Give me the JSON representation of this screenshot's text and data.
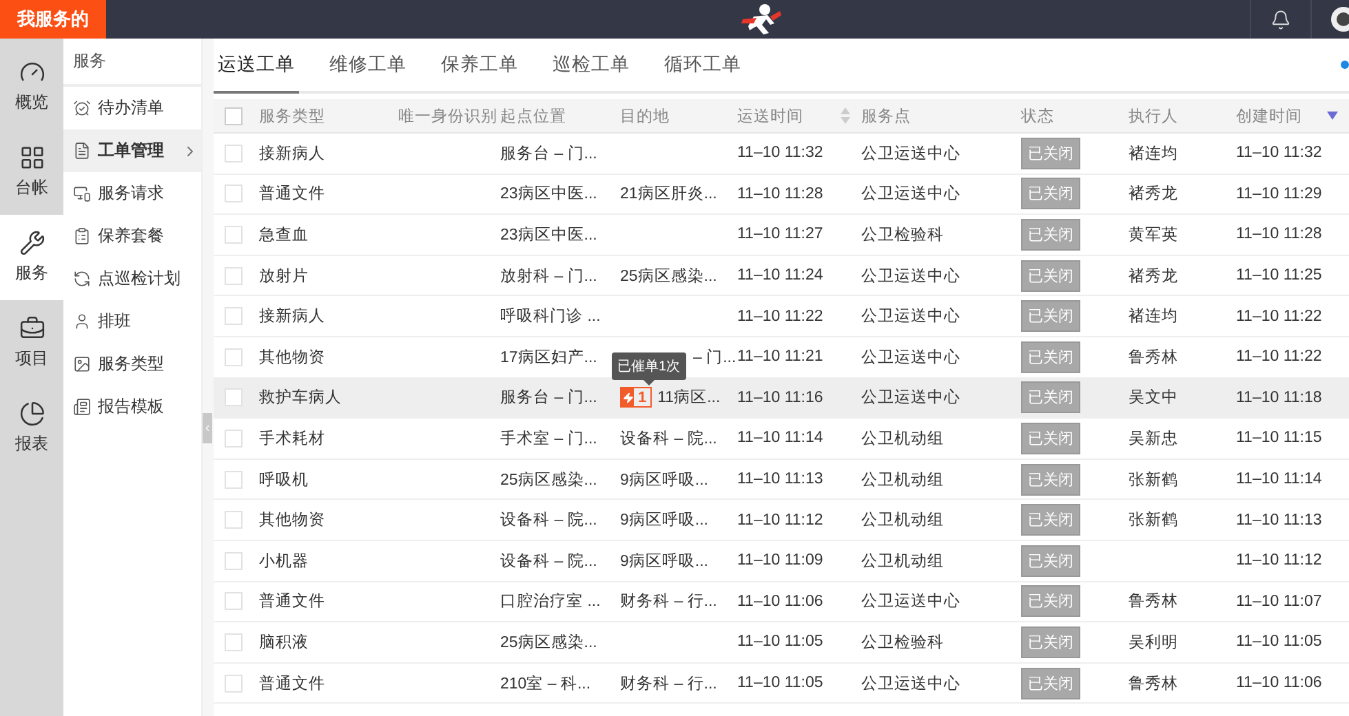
{
  "top_bar": {
    "title": "我服务的"
  },
  "rail": [
    {
      "label": "概览",
      "selected": false
    },
    {
      "label": "台帐",
      "selected": false
    },
    {
      "label": "服务",
      "selected": true
    },
    {
      "label": "项目",
      "selected": false
    },
    {
      "label": "报表",
      "selected": false
    }
  ],
  "sidebar": {
    "header": "服务",
    "items": [
      {
        "label": "待办清单",
        "selected": false,
        "expandable": false
      },
      {
        "label": "工单管理",
        "selected": true,
        "expandable": true
      },
      {
        "label": "服务请求",
        "selected": false,
        "expandable": false
      },
      {
        "label": "保养套餐",
        "selected": false,
        "expandable": false
      },
      {
        "label": "点巡检计划",
        "selected": false,
        "expandable": false
      },
      {
        "label": "排班",
        "selected": false,
        "expandable": false
      },
      {
        "label": "服务类型",
        "selected": false,
        "expandable": false
      },
      {
        "label": "报告模板",
        "selected": false,
        "expandable": false
      }
    ]
  },
  "tabs": [
    {
      "label": "运送工单",
      "selected": true
    },
    {
      "label": "维修工单",
      "selected": false
    },
    {
      "label": "保养工单",
      "selected": false
    },
    {
      "label": "巡检工单",
      "selected": false
    },
    {
      "label": "循环工单",
      "selected": false
    }
  ],
  "table": {
    "all_checked": false,
    "columns": [
      {
        "label": "服务类型"
      },
      {
        "label": "唯一身份识别"
      },
      {
        "label": "起点位置"
      },
      {
        "label": "目的地"
      },
      {
        "label": "运送时间",
        "sortable": true,
        "sorted": false
      },
      {
        "label": "服务点"
      },
      {
        "label": "状态"
      },
      {
        "label": "执行人"
      },
      {
        "label": "创建时间",
        "sortable": true,
        "sorted": true
      }
    ],
    "rows": [
      {
        "checked": false,
        "hovered": false,
        "type": "接新病人",
        "start": "服务台 – 门...",
        "destination": "",
        "time": "11–10 11:32",
        "point": "公卫运送中心",
        "status": "已关闭",
        "executor": "褚连均",
        "created": "11–10 11:32"
      },
      {
        "checked": false,
        "hovered": false,
        "type": "普通文件",
        "start": "23病区中医...",
        "destination": "21病区肝炎...",
        "time": "11–10 11:28",
        "point": "公卫运送中心",
        "status": "已关闭",
        "executor": "褚秀龙",
        "created": "11–10 11:29"
      },
      {
        "checked": false,
        "hovered": false,
        "type": "急查血",
        "start": "23病区中医...",
        "destination": "",
        "time": "11–10 11:27",
        "point": "公卫检验科",
        "status": "已关闭",
        "executor": "黄军英",
        "created": "11–10 11:28"
      },
      {
        "checked": false,
        "hovered": false,
        "type": "放射片",
        "start": "放射科 – 门...",
        "destination": "25病区感染...",
        "time": "11–10 11:24",
        "point": "公卫运送中心",
        "status": "已关闭",
        "executor": "褚秀龙",
        "created": "11–10 11:25"
      },
      {
        "checked": false,
        "hovered": false,
        "type": "接新病人",
        "start": "呼吸科门诊 ...",
        "destination": "",
        "time": "11–10 11:22",
        "point": "公卫运送中心",
        "status": "已关闭",
        "executor": "褚连均",
        "created": "11–10 11:22"
      },
      {
        "checked": false,
        "hovered": false,
        "type": "其他物资",
        "start": "17病区妇产...",
        "destination": "– 门...",
        "time": "11–10 11:21",
        "point": "公卫运送中心",
        "status": "已关闭",
        "executor": "鲁秀林",
        "created": "11–10 11:22"
      },
      {
        "checked": false,
        "hovered": true,
        "type": "救护车病人",
        "start": "服务台 – 门...",
        "urge": {
          "count": "1",
          "tooltip": "已催单1次"
        },
        "destination": "11病区...",
        "time": "11–10 11:16",
        "point": "公卫运送中心",
        "status": "已关闭",
        "executor": "吴文中",
        "created": "11–10 11:18"
      },
      {
        "checked": false,
        "hovered": false,
        "type": "手术耗材",
        "start": "手术室 – 门...",
        "destination": "设备科 – 院...",
        "time": "11–10 11:14",
        "point": "公卫机动组",
        "status": "已关闭",
        "executor": "吴新忠",
        "created": "11–10 11:15"
      },
      {
        "checked": false,
        "hovered": false,
        "type": "呼吸机",
        "start": "25病区感染...",
        "destination": "9病区呼吸...",
        "time": "11–10 11:13",
        "point": "公卫机动组",
        "status": "已关闭",
        "executor": "张新鹤",
        "created": "11–10 11:14"
      },
      {
        "checked": false,
        "hovered": false,
        "type": "其他物资",
        "start": "设备科 – 院...",
        "destination": "9病区呼吸...",
        "time": "11–10 11:12",
        "point": "公卫机动组",
        "status": "已关闭",
        "executor": "张新鹤",
        "created": "11–10 11:13"
      },
      {
        "checked": false,
        "hovered": false,
        "type": "小机器",
        "start": "设备科 – 院...",
        "destination": "9病区呼吸...",
        "time": "11–10 11:09",
        "point": "公卫机动组",
        "status": "已关闭",
        "executor": "",
        "created": "11–10 11:12"
      },
      {
        "checked": false,
        "hovered": false,
        "type": "普通文件",
        "start": "口腔治疗室 ...",
        "destination": "财务科 – 行...",
        "time": "11–10 11:06",
        "point": "公卫运送中心",
        "status": "已关闭",
        "executor": "鲁秀林",
        "created": "11–10 11:07"
      },
      {
        "checked": false,
        "hovered": false,
        "type": "脑积液",
        "start": "25病区感染...",
        "destination": "",
        "time": "11–10 11:05",
        "point": "公卫检验科",
        "status": "已关闭",
        "executor": "吴利明",
        "created": "11–10 11:05"
      },
      {
        "checked": false,
        "hovered": false,
        "type": "普通文件",
        "start": "210室 – 科...",
        "destination": "财务科 – 行...",
        "time": "11–10 11:05",
        "point": "公卫运送中心",
        "status": "已关闭",
        "executor": "鲁秀林",
        "created": "11–10 11:06"
      }
    ]
  }
}
